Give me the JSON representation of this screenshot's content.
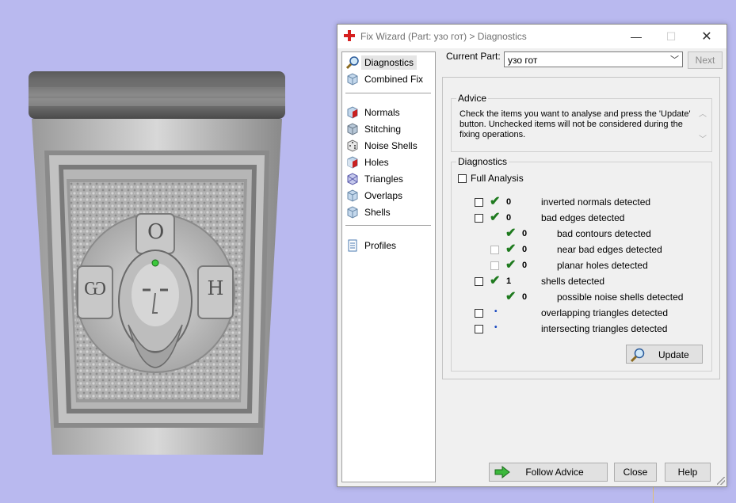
{
  "window": {
    "title": "Fix Wizard (Part: узо гот) > Diagnostics",
    "minimize_symbol": "—",
    "maximize_symbol": "☐",
    "close_symbol": "✕",
    "icon": "red-cross-icon"
  },
  "nav": {
    "items": [
      {
        "label": "Diagnostics",
        "icon": "magnifier-icon",
        "selected": true
      },
      {
        "label": "Combined Fix",
        "icon": "cube-icon",
        "selected": false
      },
      {
        "label": "Normals",
        "icon": "red-face-cube-icon",
        "selected": false
      },
      {
        "label": "Stitching",
        "icon": "cube-icon",
        "selected": false
      },
      {
        "label": "Noise Shells",
        "icon": "dice-icon",
        "selected": false
      },
      {
        "label": "Holes",
        "icon": "cube-hole-icon",
        "selected": false
      },
      {
        "label": "Triangles",
        "icon": "cube-triangles-icon",
        "selected": false
      },
      {
        "label": "Overlaps",
        "icon": "cube-icon",
        "selected": false
      },
      {
        "label": "Shells",
        "icon": "cube-icon",
        "selected": false
      },
      {
        "label": "Profiles",
        "icon": "document-icon",
        "selected": false
      }
    ]
  },
  "current_part": {
    "label": "Current Part:",
    "value": "узо гот",
    "next_label": "Next"
  },
  "advice": {
    "title": "Advice",
    "text": "Check the items you want to analyse and press the 'Update' button. Unchecked items will not be considered during the fixing operations."
  },
  "diagnostics": {
    "title": "Diagnostics",
    "full_analysis_label": "Full Analysis",
    "rows": [
      {
        "label": "inverted normals detected",
        "count": "0",
        "status": "check"
      },
      {
        "label": "bad edges detected",
        "count": "0",
        "status": "check"
      },
      {
        "label": "bad contours detected",
        "count": "0",
        "status": "check"
      },
      {
        "label": "near bad edges detected",
        "count": "0",
        "status": "check"
      },
      {
        "label": "planar holes detected",
        "count": "0",
        "status": "check"
      },
      {
        "label": "shells detected",
        "count": "1",
        "status": "check"
      },
      {
        "label": "possible noise shells detected",
        "count": "0",
        "status": "check"
      },
      {
        "label": "overlapping triangles detected",
        "count": "",
        "status": "dot"
      },
      {
        "label": "intersecting triangles detected",
        "count": "",
        "status": "dot"
      }
    ],
    "update_label": "Update"
  },
  "footer": {
    "follow_advice_label": "Follow Advice",
    "close_label": "Close",
    "help_label": "Help"
  },
  "model": {
    "letters": [
      "О",
      "Ѡ",
      "Н"
    ]
  },
  "colors": {
    "viewport_bg": "#b9b9ef",
    "check_green": "#1e7a1e",
    "dot_blue": "#1848c0",
    "brand_red": "#d62020"
  }
}
